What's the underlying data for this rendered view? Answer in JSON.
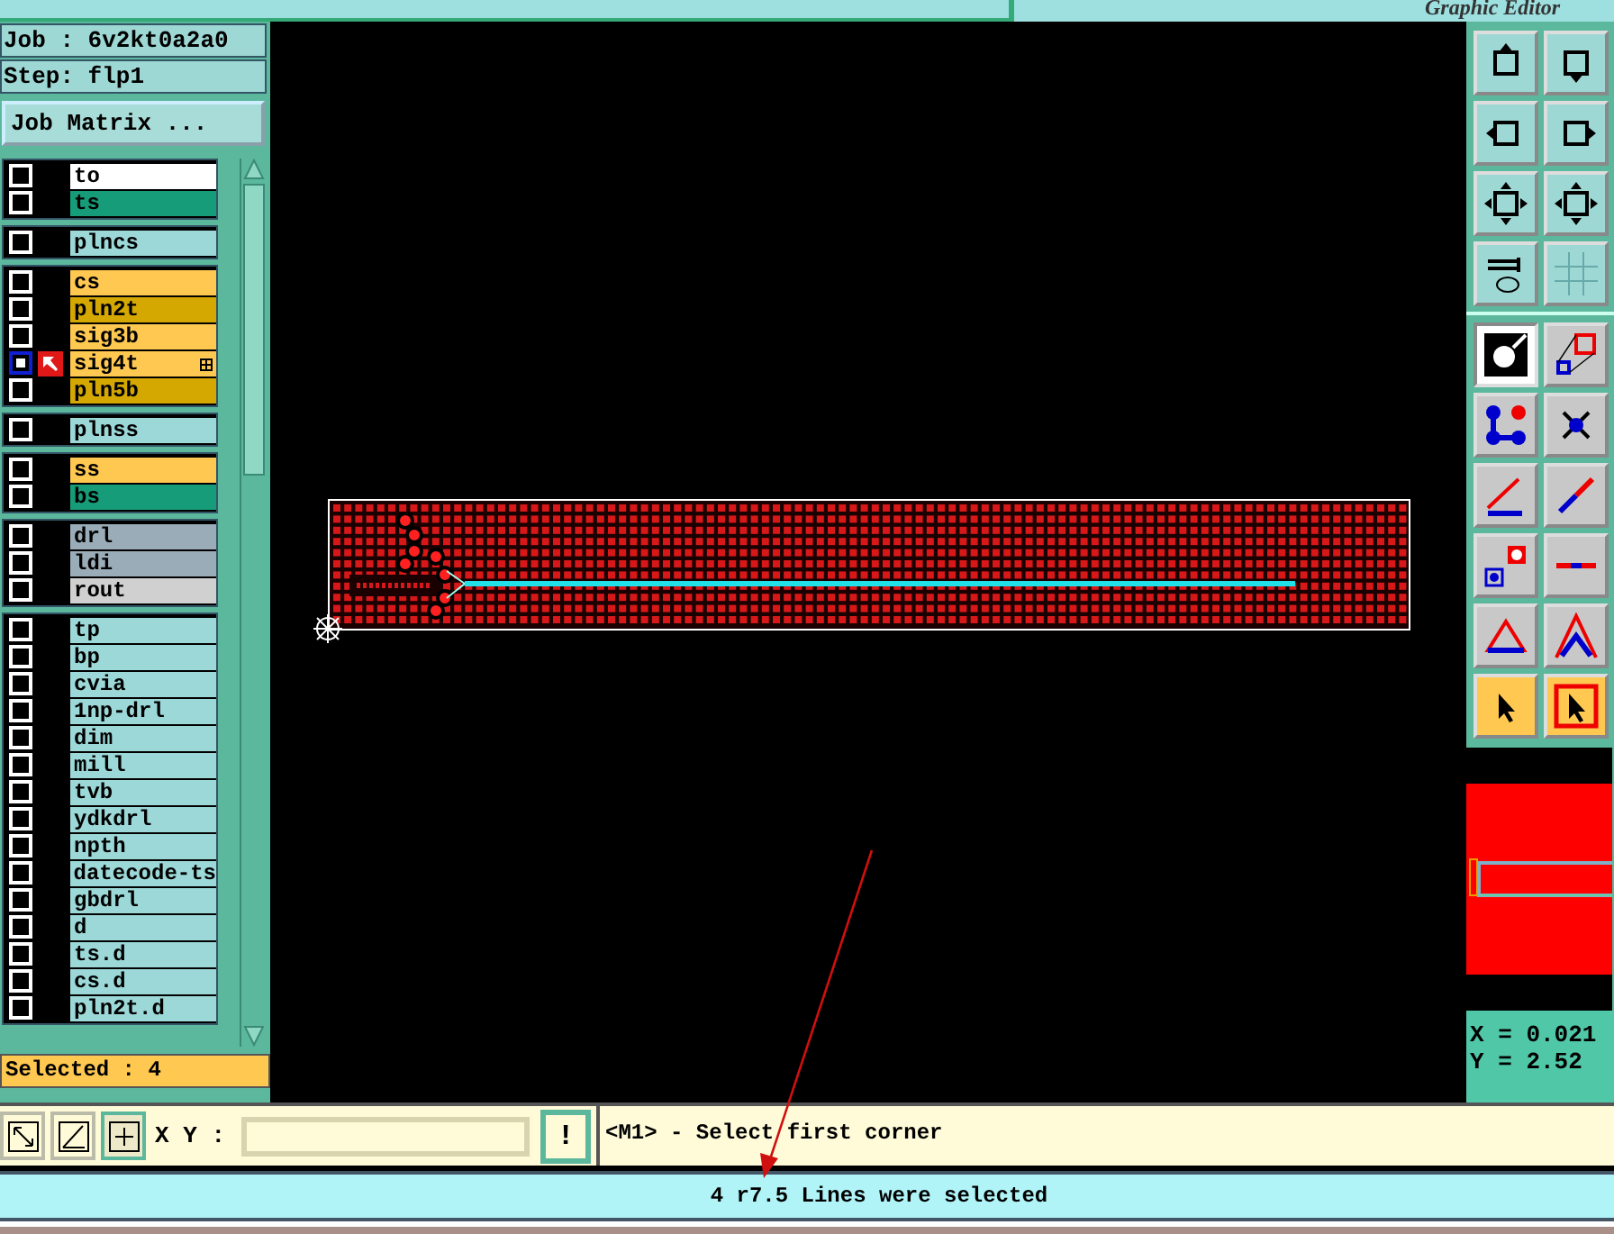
{
  "window": {
    "title": "Graphic Editor"
  },
  "job": {
    "label": "Job :",
    "value": "6v2kt0a2a0"
  },
  "step": {
    "label": "Step:",
    "value": "flp1"
  },
  "job_matrix_button": "Job Matrix ...",
  "layer_groups": [
    [
      {
        "name": "to",
        "color": "#ffffff",
        "selected": false,
        "work": false
      },
      {
        "name": "ts",
        "color": "#169c78",
        "selected": false,
        "work": false
      }
    ],
    [
      {
        "name": "plncs",
        "color": "#9cd8d8",
        "selected": false,
        "work": false
      }
    ],
    [
      {
        "name": "cs",
        "color": "#ffc850",
        "selected": false,
        "work": false
      },
      {
        "name": "pln2t",
        "color": "#d4a800",
        "selected": false,
        "work": false
      },
      {
        "name": "sig3b",
        "color": "#ffc850",
        "selected": false,
        "work": false
      },
      {
        "name": "sig4t",
        "color": "#ffc850",
        "selected": true,
        "work": true
      },
      {
        "name": "pln5b",
        "color": "#d4a800",
        "selected": false,
        "work": false
      }
    ],
    [
      {
        "name": "plnss",
        "color": "#9cd8d8",
        "selected": false,
        "work": false
      }
    ],
    [
      {
        "name": "ss",
        "color": "#ffc850",
        "selected": false,
        "work": false
      },
      {
        "name": "bs",
        "color": "#169c78",
        "selected": false,
        "work": false
      }
    ],
    [
      {
        "name": "drl",
        "color": "#9aacb8",
        "selected": false,
        "work": false
      },
      {
        "name": "ldi",
        "color": "#9aacb8",
        "selected": false,
        "work": false
      },
      {
        "name": "rout",
        "color": "#d0d0d0",
        "selected": false,
        "work": false
      }
    ],
    [
      {
        "name": "tp",
        "color": "#9cd8d8",
        "selected": false,
        "work": false
      },
      {
        "name": "bp",
        "color": "#9cd8d8",
        "selected": false,
        "work": false
      },
      {
        "name": "cvia",
        "color": "#9cd8d8",
        "selected": false,
        "work": false
      },
      {
        "name": "1np-drl",
        "color": "#9cd8d8",
        "selected": false,
        "work": false
      },
      {
        "name": "dim",
        "color": "#9cd8d8",
        "selected": false,
        "work": false
      },
      {
        "name": "mill",
        "color": "#9cd8d8",
        "selected": false,
        "work": false
      },
      {
        "name": "tvb",
        "color": "#9cd8d8",
        "selected": false,
        "work": false
      },
      {
        "name": "ydkdrl",
        "color": "#9cd8d8",
        "selected": false,
        "work": false
      },
      {
        "name": "npth",
        "color": "#9cd8d8",
        "selected": false,
        "work": false
      },
      {
        "name": "datecode-ts",
        "color": "#9cd8d8",
        "selected": false,
        "work": false
      },
      {
        "name": "gbdrl",
        "color": "#9cd8d8",
        "selected": false,
        "work": false
      },
      {
        "name": "d",
        "color": "#9cd8d8",
        "selected": false,
        "work": false
      },
      {
        "name": "ts.d",
        "color": "#9cd8d8",
        "selected": false,
        "work": false
      },
      {
        "name": "cs.d",
        "color": "#9cd8d8",
        "selected": false,
        "work": false
      },
      {
        "name": "pln2t.d",
        "color": "#9cd8d8",
        "selected": false,
        "work": false
      }
    ]
  ],
  "selected_count": "Selected : 4",
  "view_tools": [
    {
      "selected": false
    },
    {
      "selected": false
    },
    {
      "selected": false
    },
    {
      "selected": false
    },
    {
      "selected": false
    },
    {
      "selected": false
    },
    {
      "selected": false
    },
    {
      "selected": false
    }
  ],
  "edit_tools": [
    {
      "selected": true
    },
    {
      "selected": false
    },
    {
      "selected": false
    },
    {
      "selected": false
    },
    {
      "selected": false
    },
    {
      "selected": false
    },
    {
      "selected": false
    },
    {
      "selected": false
    },
    {
      "selected": false
    },
    {
      "selected": false
    }
  ],
  "select_tools": [
    {
      "selected": false
    },
    {
      "selected": false
    }
  ],
  "coordinates": {
    "x": "X = 0.021",
    "y": "Y = 2.52"
  },
  "command_bar": {
    "tools": [
      {
        "selected": false
      },
      {
        "selected": false
      },
      {
        "selected": true
      }
    ],
    "xy_label": "X Y :",
    "exclaim": "!",
    "prompt": "<M1> - Select first corner"
  },
  "status_bar": "4 r7.5 Lines were selected"
}
